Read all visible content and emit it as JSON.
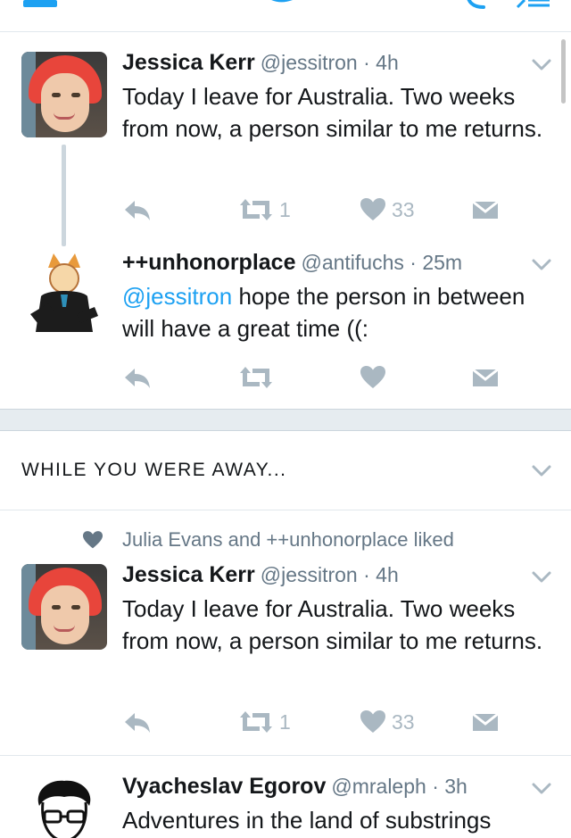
{
  "colors": {
    "accent": "#1da1f2",
    "muted": "#657786",
    "icon": "#aab8c2",
    "divider": "#e1e8ed"
  },
  "icons": [
    "menu-icon",
    "twitter-bird-icon",
    "search-icon",
    "compose-icon",
    "chevron-down-icon",
    "reply-icon",
    "retweet-icon",
    "heart-icon",
    "direct-message-icon"
  ],
  "tweets": [
    {
      "name": "Jessica Kerr",
      "meta": "@jessitron · 4h",
      "text": "Today I leave for Australia. Two weeks from now, a person similar to me returns.",
      "retweets": "1",
      "likes": "33"
    },
    {
      "name": "++unhonorplace",
      "meta": "@antifuchs · 25m",
      "mention": "@jessitron",
      "text": " hope the person in between will have a great time ((:",
      "retweets": "",
      "likes": ""
    }
  ],
  "section": {
    "title": "WHILE YOU WERE AWAY..."
  },
  "away": {
    "social_context": "Julia Evans and ++unhonorplace liked",
    "tweet": {
      "name": "Jessica Kerr",
      "meta": "@jessitron · 4h",
      "text": "Today I leave for Australia. Two weeks from now, a person similar to me returns.",
      "retweets": "1",
      "likes": "33"
    },
    "next": {
      "name": "Vyacheslav Egorov",
      "meta": "@mraleph · 3h",
      "text": "Adventures in the land of substrings"
    }
  }
}
